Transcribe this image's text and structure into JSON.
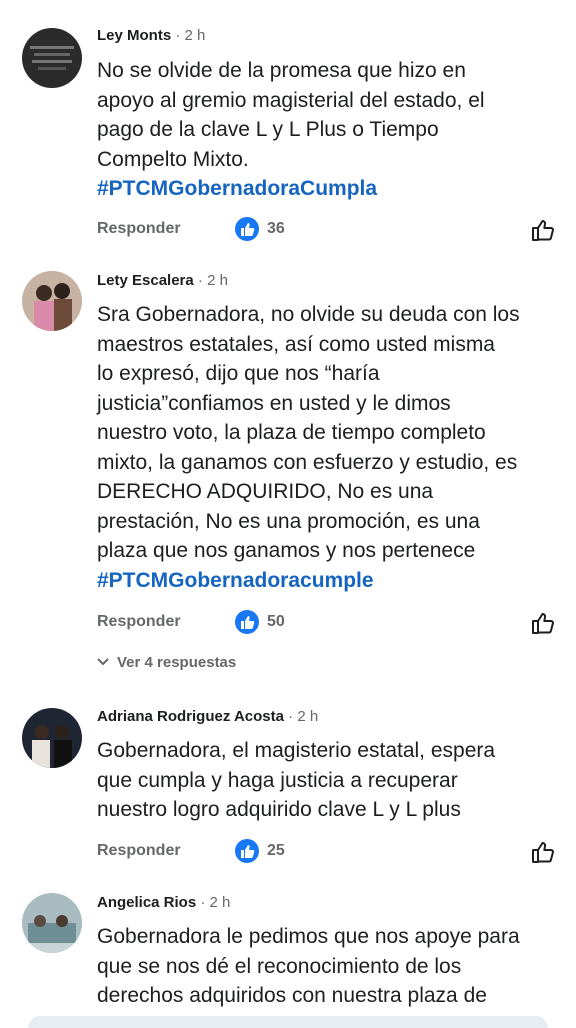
{
  "reply_label": "Responder",
  "comments": [
    {
      "author": "Ley Monts",
      "time": "· 2 h",
      "lines": [
        "No se olvide de la promesa que hizo en",
        "apoyo al gremio magisterial del estado, el",
        "pago de la clave L y L Plus o Tiempo",
        "Compelto Mixto."
      ],
      "hashtag": "#PTCMGobernadoraCumpla",
      "likes": "36",
      "avatar_color": "#2b2b2b"
    },
    {
      "author": "Lety Escalera",
      "time": "· 2 h",
      "lines": [
        "Sra Gobernadora, no olvide su deuda con los",
        "maestros estatales, así como usted misma",
        "lo expresó, dijo que nos “haría",
        "justicia”confiamos en usted y le dimos",
        "nuestro voto, la plaza de tiempo completo",
        "mixto, la ganamos con esfuerzo y estudio, es",
        "DERECHO ADQUIRIDO, No es una",
        "prestación, No es una promoción, es una",
        "plaza que nos ganamos y nos pertenece"
      ],
      "hashtag": "#PTCMGobernadoracumple",
      "likes": "50",
      "view_replies": "Ver 4 respuestas",
      "avatar_color": "#b89a86"
    },
    {
      "author": "Adriana Rodriguez Acosta",
      "time": "· 2 h",
      "lines": [
        "Gobernadora, el magisterio estatal, espera",
        "que cumpla y haga justicia a recuperar",
        "nuestro logro adquirido clave L y L plus"
      ],
      "likes": "25",
      "avatar_color": "#2a2f3a"
    },
    {
      "author": "Angelica Rios",
      "time": "· 2 h",
      "lines": [
        "Gobernadora le pedimos que nos apoye para",
        "que se nos dé el reconocimiento de los",
        "derechos adquiridos con nuestra plaza de"
      ],
      "avatar_color": "#8fa3a8"
    }
  ],
  "colors": {
    "hashtag": "#1565c0",
    "like_badge": "#1877f2",
    "muted_text": "#65676b"
  }
}
